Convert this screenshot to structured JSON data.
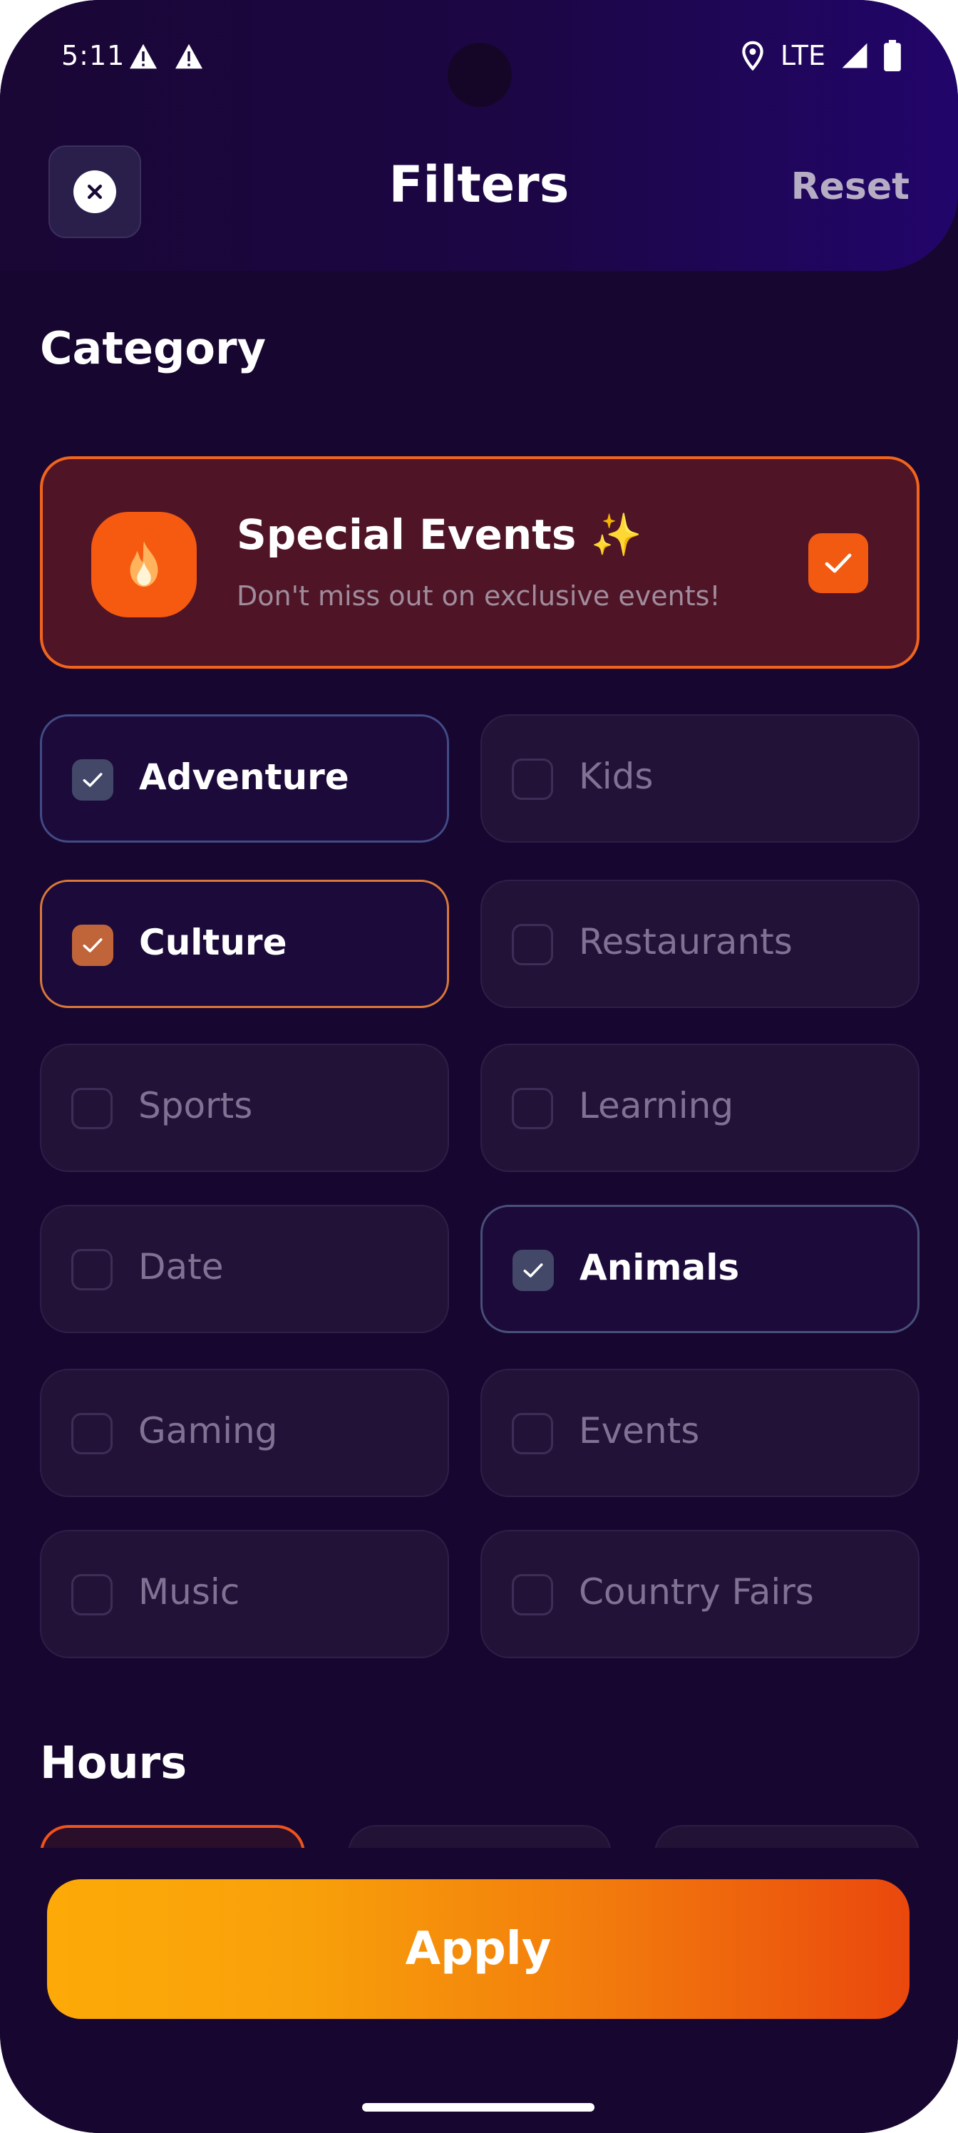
{
  "status_bar": {
    "time": "5:11",
    "network": "LTE",
    "icons": [
      "warning-icon",
      "warning-icon",
      "location-icon",
      "signal-icon",
      "battery-icon"
    ]
  },
  "header": {
    "title": "Filters",
    "reset_label": "Reset",
    "close_icon": "close-icon"
  },
  "category": {
    "title": "Category",
    "special": {
      "title": "Special Events ✨",
      "subtitle": "Don't miss out on exclusive events!",
      "icon": "fire-icon",
      "checked": true
    },
    "options": [
      {
        "label": "Adventure",
        "checked": true
      },
      {
        "label": "Kids",
        "checked": false
      },
      {
        "label": "Culture",
        "checked": true
      },
      {
        "label": "Restaurants",
        "checked": false
      },
      {
        "label": "Sports",
        "checked": false
      },
      {
        "label": "Learning",
        "checked": false
      },
      {
        "label": "Date",
        "checked": false
      },
      {
        "label": "Animals",
        "checked": true
      },
      {
        "label": "Gaming",
        "checked": false
      },
      {
        "label": "Events",
        "checked": false
      },
      {
        "label": "Music",
        "checked": false
      },
      {
        "label": "Country Fairs",
        "checked": false
      }
    ]
  },
  "hours": {
    "title": "Hours"
  },
  "apply_label": "Apply",
  "colors": {
    "background": "#170730",
    "accent_orange": "#f25a11",
    "apply_gradient_start": "#fdaa08",
    "apply_gradient_end": "#ea480d"
  }
}
